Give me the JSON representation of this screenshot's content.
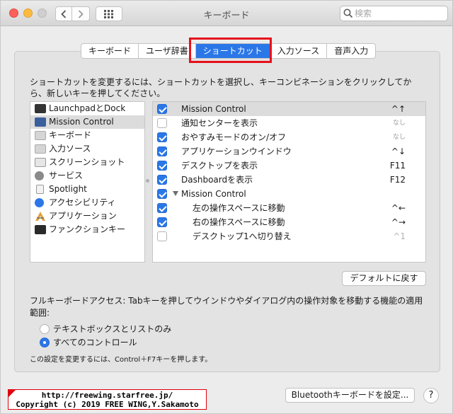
{
  "window": {
    "title": "キーボード"
  },
  "search": {
    "placeholder": "検索"
  },
  "tabs": [
    {
      "label": "キーボード"
    },
    {
      "label": "ユーザ辞書"
    },
    {
      "label": "ショートカット"
    },
    {
      "label": "入力ソース"
    },
    {
      "label": "音声入力"
    }
  ],
  "description": "ショートカットを変更するには、ショートカットを選択し、キーコンビネーションをクリックしてから、新しいキーを押してください。",
  "categories": [
    {
      "label": "LaunchpadとDock",
      "icon": "launchpad-icon",
      "color": "#333333"
    },
    {
      "label": "Mission Control",
      "icon": "mission-control-icon",
      "color": "#3a5f9c"
    },
    {
      "label": "キーボード",
      "icon": "keyboard-icon",
      "color": "#d5d5d5"
    },
    {
      "label": "入力ソース",
      "icon": "input-source-icon",
      "color": "#d5d5d5"
    },
    {
      "label": "スクリーンショット",
      "icon": "screenshot-icon",
      "color": "#e6e6e6"
    },
    {
      "label": "サービス",
      "icon": "services-gear-icon",
      "color": "#8a8a8a"
    },
    {
      "label": "Spotlight",
      "icon": "spotlight-icon",
      "color": "#f2f2f2"
    },
    {
      "label": "アクセシビリティ",
      "icon": "accessibility-icon",
      "color": "#2b77e8"
    },
    {
      "label": "アプリケーション",
      "icon": "applications-icon",
      "color": "#e0a03a"
    },
    {
      "label": "ファンクションキー",
      "icon": "fn-key-icon",
      "color": "#2a2a2a"
    }
  ],
  "shortcuts": [
    {
      "label": "Mission Control",
      "key": "^↑",
      "checked": true
    },
    {
      "label": "通知センターを表示",
      "key": "なし",
      "checked": false
    },
    {
      "label": "おやすみモードのオン/オフ",
      "key": "なし",
      "checked": true
    },
    {
      "label": "アプリケーションウインドウ",
      "key": "^↓",
      "checked": true
    },
    {
      "label": "デスクトップを表示",
      "key": "F11",
      "checked": true
    },
    {
      "label": "Dashboardを表示",
      "key": "F12",
      "checked": true
    },
    {
      "label": "Mission Control",
      "key": "",
      "checked": true
    },
    {
      "label": "左の操作スペースに移動",
      "key": "^←",
      "checked": true
    },
    {
      "label": "右の操作スペースに移動",
      "key": "^→",
      "checked": true
    },
    {
      "label": "デスクトップ1へ切り替え",
      "key": "^1",
      "checked": false
    }
  ],
  "buttons": {
    "restore_defaults": "デフォルトに戻す",
    "bluetooth_setup": "Bluetoothキーボードを設定...",
    "help": "?"
  },
  "full_keyboard_access": {
    "description": "フルキーボードアクセス: Tabキーを押してウインドウやダイアログ内の操作対象を移動する機能の適用範囲:",
    "options": [
      {
        "label": "テキストボックスとリストのみ",
        "selected": false
      },
      {
        "label": "すべてのコントロール",
        "selected": true
      }
    ],
    "note": "この設定を変更するには、Control＋F7キーを押します。"
  },
  "watermark": {
    "line1": "http://freewing.starfree.jp/",
    "line2": "Copyright (c) 2019 FREE WING,Y.Sakamoto"
  },
  "colors": {
    "accent": "#2b77e8",
    "highlight_box": "#e6111b"
  }
}
